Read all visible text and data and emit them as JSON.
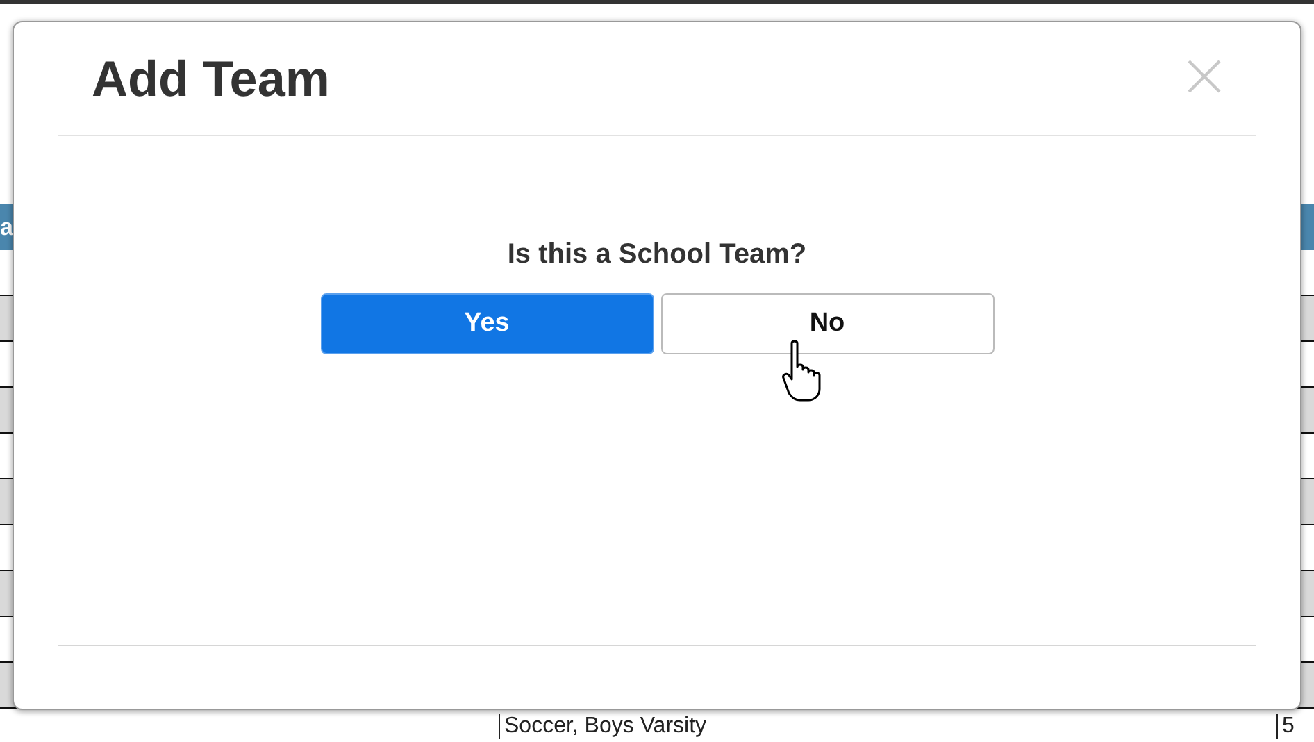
{
  "background_table": {
    "header_text": "a",
    "rows": [
      {
        "column_1": "Soccer, Boys Varsity",
        "column_2": "5"
      }
    ]
  },
  "dialog": {
    "title": "Add Team",
    "question": "Is this a School Team?",
    "buttons": [
      {
        "label": "Yes",
        "kind": "primary"
      },
      {
        "label": "No",
        "kind": "secondary"
      }
    ]
  }
}
